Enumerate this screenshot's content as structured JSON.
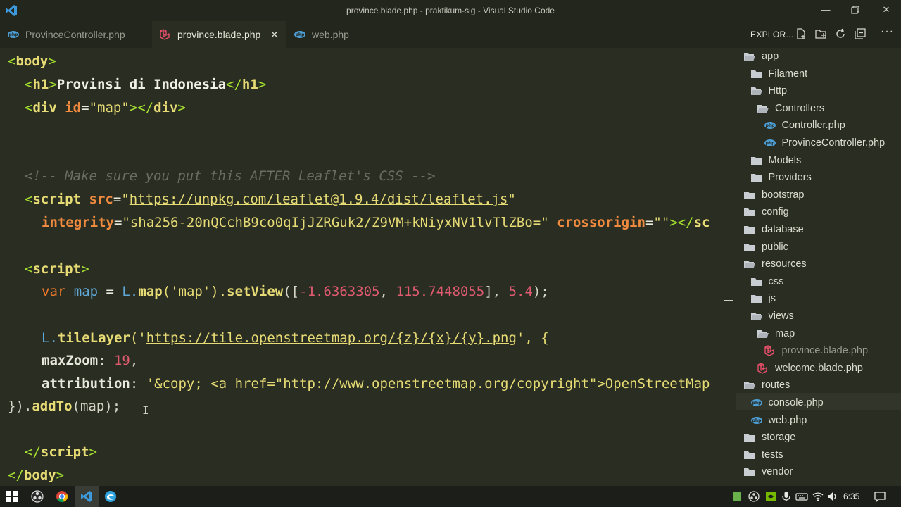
{
  "window": {
    "title": "province.blade.php - praktikum-sig - Visual Studio Code",
    "controls": [
      "minimize-icon",
      "restore-icon",
      "close-icon"
    ]
  },
  "tabs": [
    {
      "label": "ProvinceController.php",
      "icon": "php-icon",
      "active": false
    },
    {
      "label": "province.blade.php",
      "icon": "laravel-icon",
      "active": true,
      "close": "✕"
    },
    {
      "label": "web.php",
      "icon": "php-icon",
      "active": false
    }
  ],
  "editor": {
    "lines": {
      "l1": [
        "<",
        "body",
        ">"
      ],
      "l2": [
        "<",
        "h1",
        ">",
        "Provinsi di Indonesia",
        "</",
        "h1",
        ">"
      ],
      "l3": [
        "<",
        "div",
        " id",
        "=",
        "\"map\"",
        "></",
        "div",
        ">"
      ],
      "l4": [
        "<!-- Make sure you put this AFTER Leaflet's CSS -->"
      ],
      "l5": [
        "<",
        "script",
        " src",
        "=",
        "\"",
        "https://unpkg.com/leaflet@1.9.4/dist/leaflet.js",
        "\""
      ],
      "l6": [
        "integrity",
        "=",
        "\"sha256-20nQCchB9co0qIjJZRGuk2/Z9VM+kNiyxNV1lvTlZBo=\"",
        " crossorigin",
        "=",
        "\"\"",
        "></",
        "sc"
      ],
      "l7": [
        "<",
        "script",
        ">"
      ],
      "l8": [
        "var",
        " map ",
        "=",
        " L.",
        "map",
        "('map').",
        "setView",
        "([",
        "-1.6363305",
        ", ",
        "115.7448055",
        "], ",
        "5.4",
        ");"
      ],
      "l9": [
        "L.",
        "tileLayer",
        "('",
        "https://tile.openstreetmap.org/{z}/{x}/{y}.png",
        "', {"
      ],
      "l10": [
        "maxZoom",
        ": ",
        "19",
        ","
      ],
      "l11": [
        "attribution",
        ": ",
        "'&copy; <a href=\"",
        "http://www.openstreetmap.org/copyright",
        "\">OpenStreetMap"
      ],
      "l12": [
        "})",
        ".",
        "addTo",
        "(map);"
      ],
      "l13": [
        "</",
        "script",
        ">"
      ],
      "l14": [
        "</",
        "body",
        ">"
      ]
    }
  },
  "explorer": {
    "title": "EXPLOR...",
    "actions": [
      "new-file-icon",
      "new-folder-icon",
      "refresh-icon",
      "collapse-all-icon"
    ],
    "tree": [
      {
        "label": "app",
        "type": "folder-open",
        "depth": 0
      },
      {
        "label": "Filament",
        "type": "folder",
        "depth": 1
      },
      {
        "label": "Http",
        "type": "folder-open",
        "depth": 1
      },
      {
        "label": "Controllers",
        "type": "folder-open",
        "depth": 2
      },
      {
        "label": "Controller.php",
        "type": "php",
        "depth": 3
      },
      {
        "label": "ProvinceController.php",
        "type": "php",
        "depth": 3
      },
      {
        "label": "Models",
        "type": "folder",
        "depth": 1
      },
      {
        "label": "Providers",
        "type": "folder",
        "depth": 1
      },
      {
        "label": "bootstrap",
        "type": "folder",
        "depth": 0
      },
      {
        "label": "config",
        "type": "folder",
        "depth": 0
      },
      {
        "label": "database",
        "type": "folder",
        "depth": 0
      },
      {
        "label": "public",
        "type": "folder",
        "depth": 0
      },
      {
        "label": "resources",
        "type": "folder-open",
        "depth": 0
      },
      {
        "label": "css",
        "type": "folder",
        "depth": 1
      },
      {
        "label": "js",
        "type": "folder",
        "depth": 1
      },
      {
        "label": "views",
        "type": "folder-open",
        "depth": 1
      },
      {
        "label": "map",
        "type": "folder-open",
        "depth": 2
      },
      {
        "label": "province.blade.php",
        "type": "laravel",
        "depth": 3
      },
      {
        "label": "welcome.blade.php",
        "type": "laravel",
        "depth": 2
      },
      {
        "label": "routes",
        "type": "folder-open",
        "depth": 0
      },
      {
        "label": "console.php",
        "type": "php",
        "depth": 1
      },
      {
        "label": "web.php",
        "type": "php",
        "depth": 1
      },
      {
        "label": "storage",
        "type": "folder",
        "depth": 0
      },
      {
        "label": "tests",
        "type": "folder",
        "depth": 0
      },
      {
        "label": "vendor",
        "type": "folder",
        "depth": 0
      }
    ]
  },
  "taskbar": {
    "time": "6:35",
    "apps": [
      "windows-start-icon",
      "obs-icon",
      "chrome-icon",
      "vscode-icon",
      "edge-icon"
    ]
  }
}
